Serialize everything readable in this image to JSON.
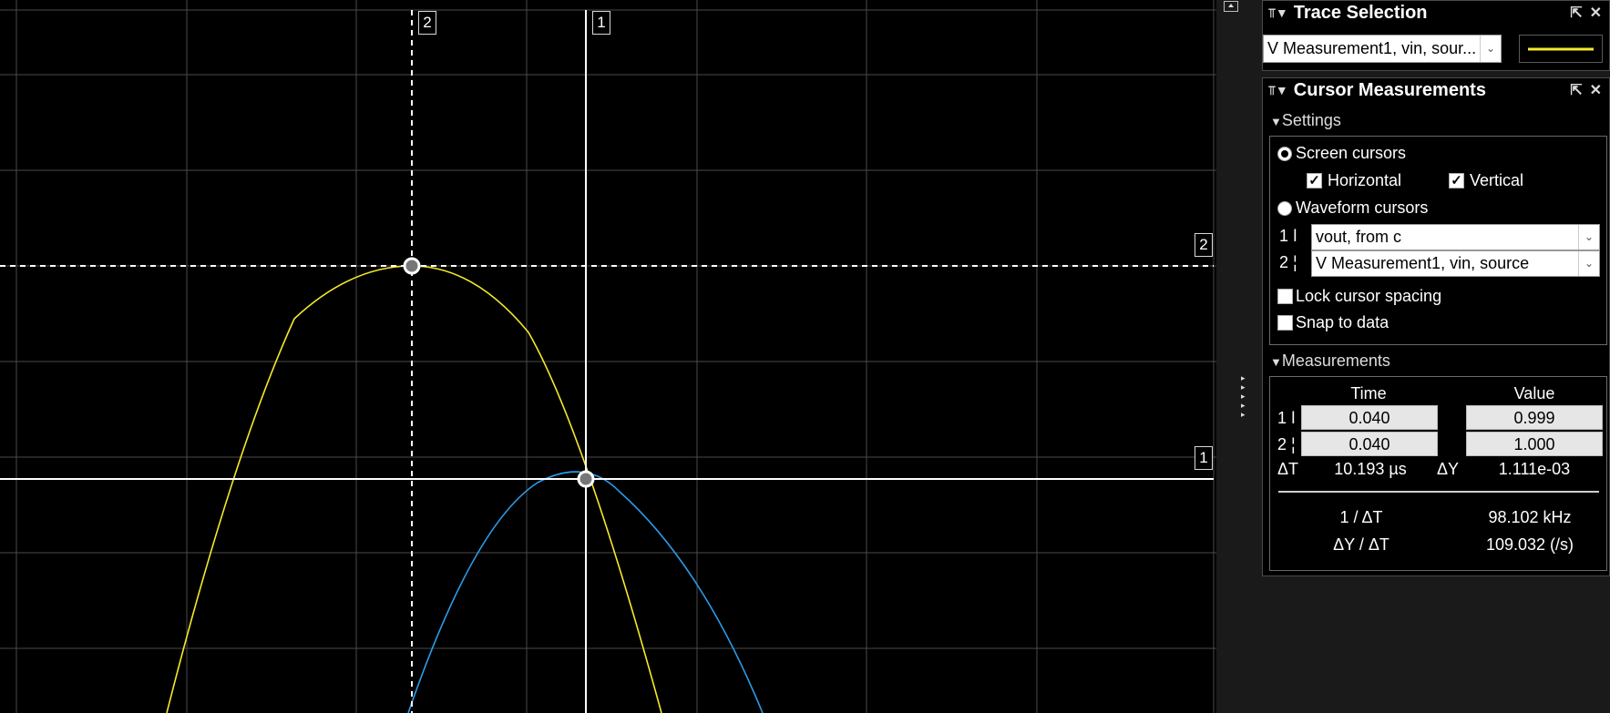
{
  "scope": {
    "cursor_v2_tag": "2",
    "cursor_v1_tag": "1",
    "cursor_h2_tag": "2",
    "cursor_h1_tag": "1",
    "trace_colors": {
      "vin": "#f5ea2a",
      "vout": "#2b9bea"
    }
  },
  "trace_selection": {
    "title": "Trace Selection",
    "selected": "V Measurement1, vin, sour...",
    "line_color": "#f5ea2a"
  },
  "cursor_measurements": {
    "title": "Cursor Measurements",
    "settings": {
      "label": "Settings",
      "screen_cursors": "Screen cursors",
      "horizontal": "Horizontal",
      "vertical": "Vertical",
      "waveform_cursors": "Waveform cursors",
      "cursor1_label": "1",
      "cursor1_value": "vout, from c",
      "cursor2_label": "2",
      "cursor2_value": "V Measurement1, vin, source",
      "lock_spacing": "Lock cursor spacing",
      "snap_to_data": "Snap to data"
    },
    "measurements": {
      "label": "Measurements",
      "col_time": "Time",
      "col_value": "Value",
      "rows": [
        {
          "label": "1",
          "time": "0.040",
          "value": "0.999"
        },
        {
          "label": "2",
          "time": "0.040",
          "value": "1.000"
        }
      ],
      "dt_label": "ΔT",
      "dt_value": "10.193 µs",
      "dy_label": "ΔY",
      "dy_value": "1.111e-03",
      "inv_dt_label": "1 / ΔT",
      "inv_dt_value": "98.102 kHz",
      "dydt_label": "ΔY / ΔT",
      "dydt_value": "109.032 (/s)"
    }
  }
}
